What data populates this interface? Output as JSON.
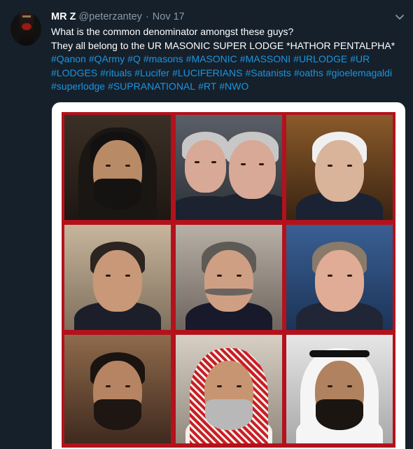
{
  "tweet": {
    "display_name": "MR Z",
    "handle": "@peterzantey",
    "separator": "·",
    "date": "Nov 17",
    "text_line1": "What is the common denominator amongst these guys?",
    "text_line2": "They all belong to the UR MASONIC SUPER LODGE *HATHOR PENTALPHA*",
    "hashtag_lines": [
      [
        "#Qanon",
        "#QArmy",
        "#Q",
        "#masons",
        "#MASONIC",
        "#MASSONI",
        "#URLODGE",
        "#UR"
      ],
      [
        "#LODGES",
        "#rituals",
        "#Lucifer",
        "#LUCIFERIANS",
        "#Satanists",
        "#oaths",
        "#gioelemagaldi"
      ],
      [
        "#superlodge",
        "#SUPRANATIONAL",
        "#RT",
        "#NWO"
      ]
    ]
  },
  "icons": {
    "avatar": "avatar-book-cover",
    "more": "chevron-down-icon"
  },
  "colors": {
    "background": "#15202b",
    "text": "#ffffff",
    "muted": "#8899a6",
    "link": "#1b95e0",
    "grid_border": "#b3121c"
  }
}
